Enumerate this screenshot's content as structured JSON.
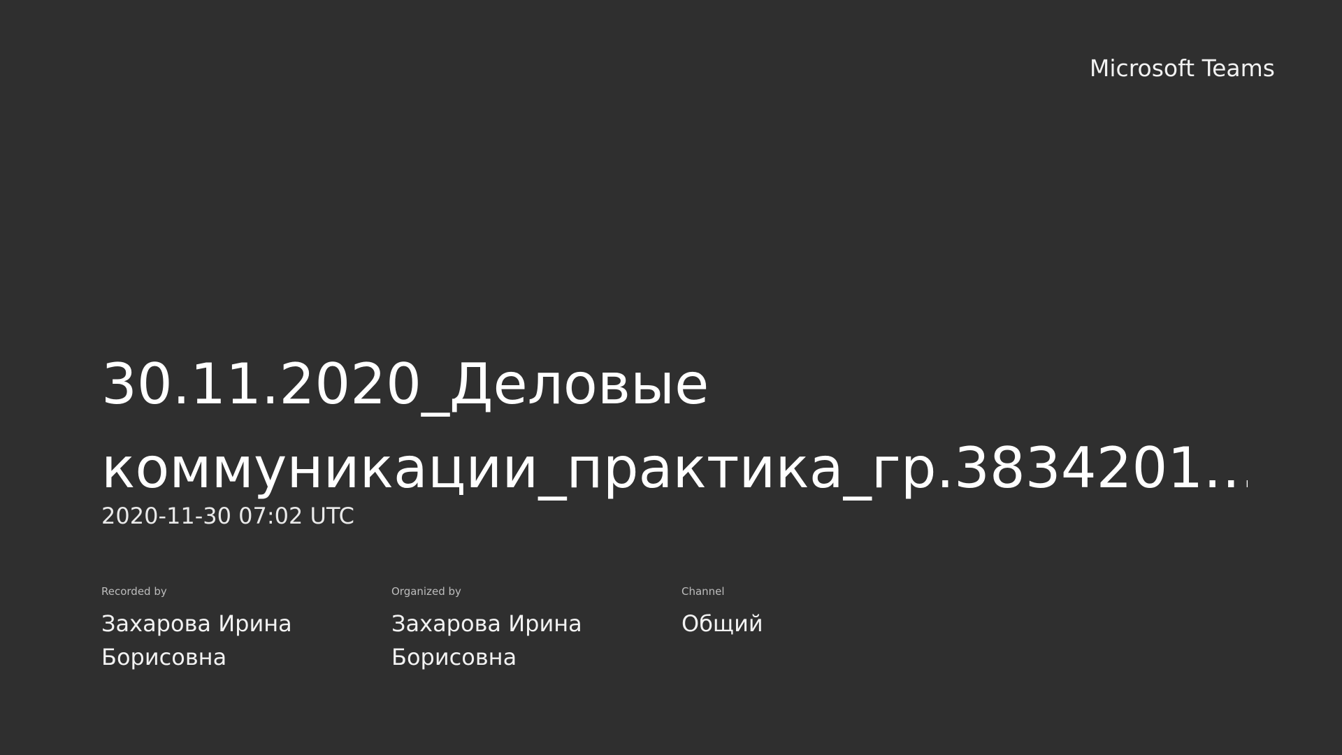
{
  "app": {
    "brand": "Microsoft Teams"
  },
  "meeting": {
    "title": "30.11.2020_Деловые коммуникации_практика_гр.3834201…",
    "timestamp": "2020-11-30 07:02 UTC",
    "details": [
      {
        "label": "Recorded by",
        "value": "Захарова Ирина Борисовна"
      },
      {
        "label": "Organized by",
        "value": "Захарова Ирина Борисовна"
      },
      {
        "label": "Channel",
        "value": "Общий"
      }
    ]
  },
  "colors": {
    "background": "#2f2f2f",
    "text": "#ffffff",
    "muted": "#bdbdbd"
  }
}
